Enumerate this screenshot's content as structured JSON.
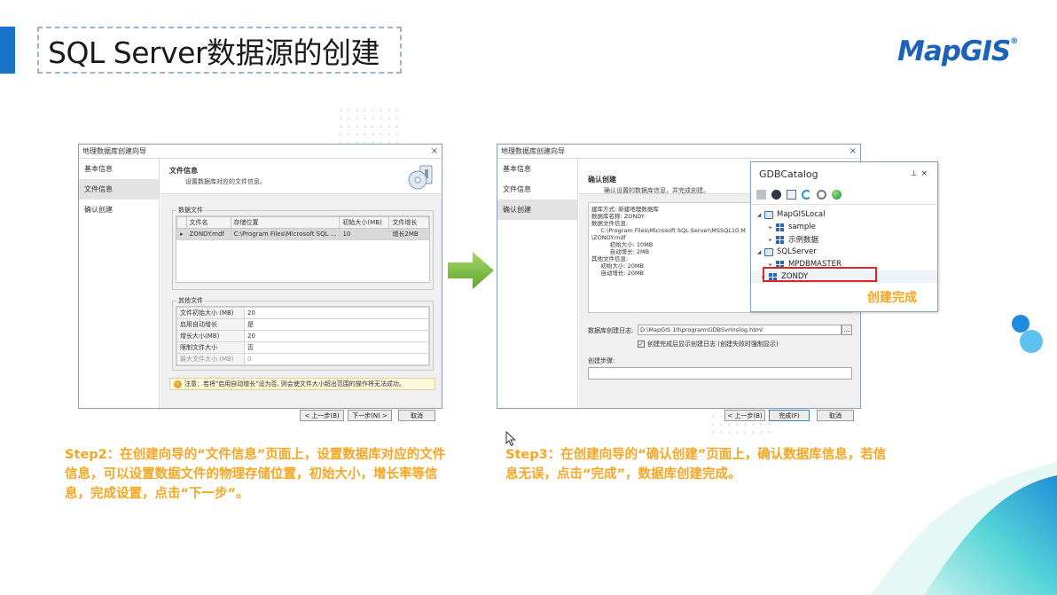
{
  "slide": {
    "title": "SQL Server数据源的创建",
    "logo": "MapGIS",
    "logo_mark": "®",
    "accent_color": "#1a73c8",
    "highlight_color": "#f5a623"
  },
  "left_window": {
    "title": "地理数据库创建向导",
    "close_label": "×",
    "nav": [
      "基本信息",
      "文件信息",
      "确认创建"
    ],
    "active_nav": 1,
    "header_title": "文件信息",
    "header_subtitle": "设置数据库对应的文件信息。",
    "data_files_legend": "数据文件",
    "data_files_columns": [
      "文件名",
      "存储位置",
      "初始大小(MB)",
      "文件增长"
    ],
    "data_files_rows": [
      [
        "ZONDY.mdf",
        "C:\\Program Files\\Microsoft SQL ...",
        "10",
        "增长2MB"
      ]
    ],
    "other_files_legend": "其他文件",
    "other_files_rows": [
      [
        "文件初始大小 (MB)",
        "20"
      ],
      [
        "启用自动增长",
        "是"
      ],
      [
        "增长大小(MB)",
        "20"
      ],
      [
        "限制文件大小",
        "否"
      ],
      [
        "最大文件大小 (MB)",
        "0"
      ]
    ],
    "note": "注意：若将\"启用自动增长\"设为否, 则会使文件大小超出范围的操作将无法成功。",
    "buttons": {
      "prev": "< 上一步(B)",
      "next": "下一步(N) >",
      "cancel": "取消"
    }
  },
  "right_window": {
    "title": "地理数据库创建向导",
    "close_label": "×",
    "nav": [
      "基本信息",
      "文件信息",
      "确认创建"
    ],
    "active_nav": 2,
    "header_title": "确认创建",
    "header_subtitle": "确认设置的数据库信息，并完成创建。",
    "summary_lines": [
      "建库方式: 新建地理数据库",
      "数据库名称: ZONDY",
      "数据文件信息:",
      "     C:\\Program Files\\Microsoft SQL Server\\MSSQL10.M",
      "\\ZONDY.mdf",
      "          初始大小: 10MB",
      "          自动增长: 2MB",
      "其他文件信息:",
      "     初始大小: 20MB",
      "     自动增长: 20MB"
    ],
    "log_label": "数据库创建日志:",
    "log_path": "D:\\MapGIS 10\\program\\GDBSvrInslog.html",
    "log_browse": "...",
    "show_log_checkbox": "创建完成后显示创建日志 (创建失败时强制显示)",
    "show_log_checked": true,
    "steps_label": "创建步骤:",
    "buttons": {
      "prev": "< 上一步(B)",
      "finish": "完成(F)",
      "cancel": "取消"
    }
  },
  "catalog": {
    "title": "GDBCatalog",
    "pin": "⊥",
    "close": "×",
    "tree": [
      {
        "label": "MapGISLocal",
        "level": 0,
        "icon": "pc-icon",
        "arrow": "◢"
      },
      {
        "label": "sample",
        "level": 1,
        "icon": "db-icon",
        "arrow": "▸"
      },
      {
        "label": "示例数据",
        "level": 1,
        "icon": "db-icon",
        "arrow": "▸"
      },
      {
        "label": "SQLServer",
        "level": 0,
        "icon": "pc-icon",
        "arrow": "◢"
      },
      {
        "label": "MPDBMASTER",
        "level": 1,
        "icon": "db-icon",
        "arrow": "▸"
      },
      {
        "label": "ZONDY",
        "level": 1,
        "icon": "db-icon",
        "arrow": "▸"
      }
    ],
    "done_label": "创建完成"
  },
  "steps": {
    "step2": "Step2：在创建向导的“文件信息”页面上，设置数据库对应的文件信息，可以设置数据文件的物理存储位置，初始大小，增长率等信息，完成设置，点击“下一步”。",
    "step3": "Step3：在创建向导的“确认创建”页面上，确认数据库信息，若信息无误，点击“完成”，数据库创建完成。"
  }
}
